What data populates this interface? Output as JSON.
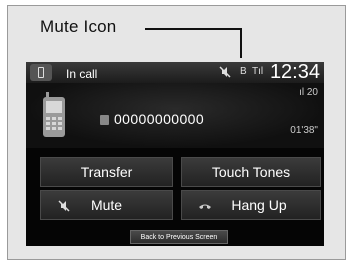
{
  "callout": {
    "label": "Mute Icon"
  },
  "status_bar": {
    "title": "In call",
    "time": "12:34",
    "bluetooth": "B",
    "signal": "Tıl"
  },
  "call_info": {
    "phone_number": "00000000000",
    "signal_strength": "20",
    "duration": "01'38\""
  },
  "buttons": {
    "transfer": "Transfer",
    "touch_tones": "Touch Tones",
    "mute": "Mute",
    "hang_up": "Hang Up",
    "back": "Back to Previous Screen"
  },
  "colors": {
    "screen_bg": "#050505",
    "text": "#ffffff",
    "button_bg": "#2e2e2e"
  }
}
